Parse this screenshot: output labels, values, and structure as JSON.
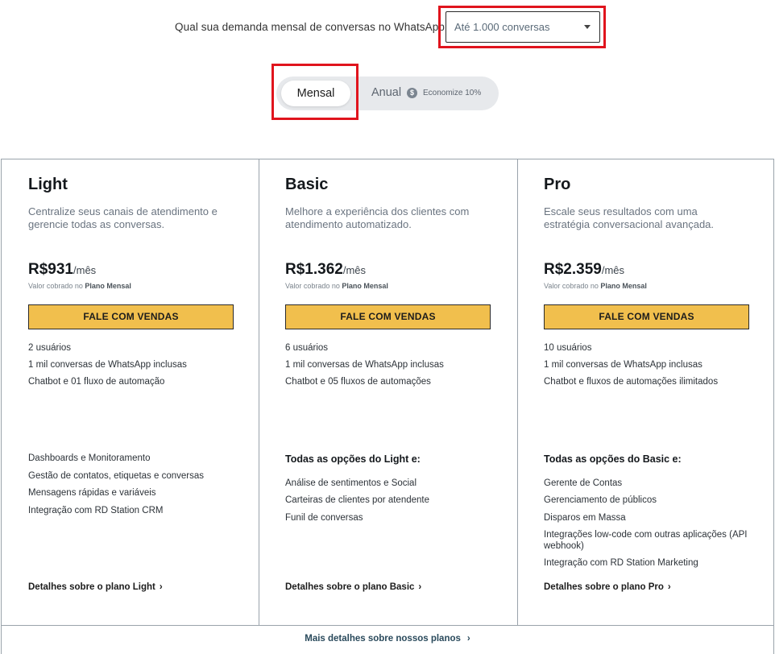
{
  "demand": {
    "label": "Qual sua demanda mensal de conversas no WhatsApp:",
    "selected": "Até 1.000 conversas"
  },
  "billing_toggle": {
    "mensal_label": "Mensal",
    "anual_label": "Anual",
    "discount_label": "Economize 10%",
    "discount_icon": "$"
  },
  "plans": [
    {
      "name": "Light",
      "description": "Centralize seus canais de atendimento e gerencie todas as conversas.",
      "price": "R$931",
      "per": "/mês",
      "note_prefix": "Valor cobrado no ",
      "note_bold": "Plano Mensal",
      "cta": "FALE COM VENDAS",
      "features": [
        "2 usuários",
        "1 mil conversas de WhatsApp inclusas",
        "Chatbot e 01 fluxo de automação"
      ],
      "section_title": "",
      "extras": [
        "Dashboards e Monitoramento",
        "Gestão de contatos, etiquetas e conversas",
        "Mensagens rápidas e variáveis",
        "Integração com RD Station CRM"
      ],
      "details_link": "Detalhes sobre o plano Light"
    },
    {
      "name": "Basic",
      "description": "Melhore a experiência dos clientes com atendimento automatizado.",
      "price": "R$1.362",
      "per": "/mês",
      "note_prefix": "Valor cobrado no ",
      "note_bold": "Plano Mensal",
      "cta": "FALE COM VENDAS",
      "features": [
        "6 usuários",
        "1 mil conversas de WhatsApp inclusas",
        "Chatbot e 05 fluxos de automações"
      ],
      "section_title": "Todas as opções do Light e:",
      "extras": [
        "Análise de sentimentos e Social",
        "Carteiras de clientes por atendente",
        "Funil de conversas"
      ],
      "details_link": "Detalhes sobre o plano Basic"
    },
    {
      "name": "Pro",
      "description": "Escale seus resultados com uma estratégia conversacional avançada.",
      "price": "R$2.359",
      "per": "/mês",
      "note_prefix": "Valor cobrado no ",
      "note_bold": "Plano Mensal",
      "cta": "FALE COM VENDAS",
      "features": [
        "10 usuários",
        "1 mil conversas de WhatsApp inclusas",
        "Chatbot e fluxos de automações ilimitados"
      ],
      "section_title": "Todas as opções do Basic e:",
      "extras": [
        "Gerente de Contas",
        "Gerenciamento de públicos",
        "Disparos em Massa",
        "Integrações low-code com outras aplicações (API webhook)",
        "Integração com RD Station Marketing"
      ],
      "details_link": "Detalhes sobre o plano Pro"
    }
  ],
  "footer": {
    "link": "Mais detalhes sobre nossos planos",
    "chevron": "›"
  },
  "colors": {
    "cta": "#f1bf4d",
    "highlight": "#e0141d",
    "toggle_bg": "#e7e9ec"
  }
}
